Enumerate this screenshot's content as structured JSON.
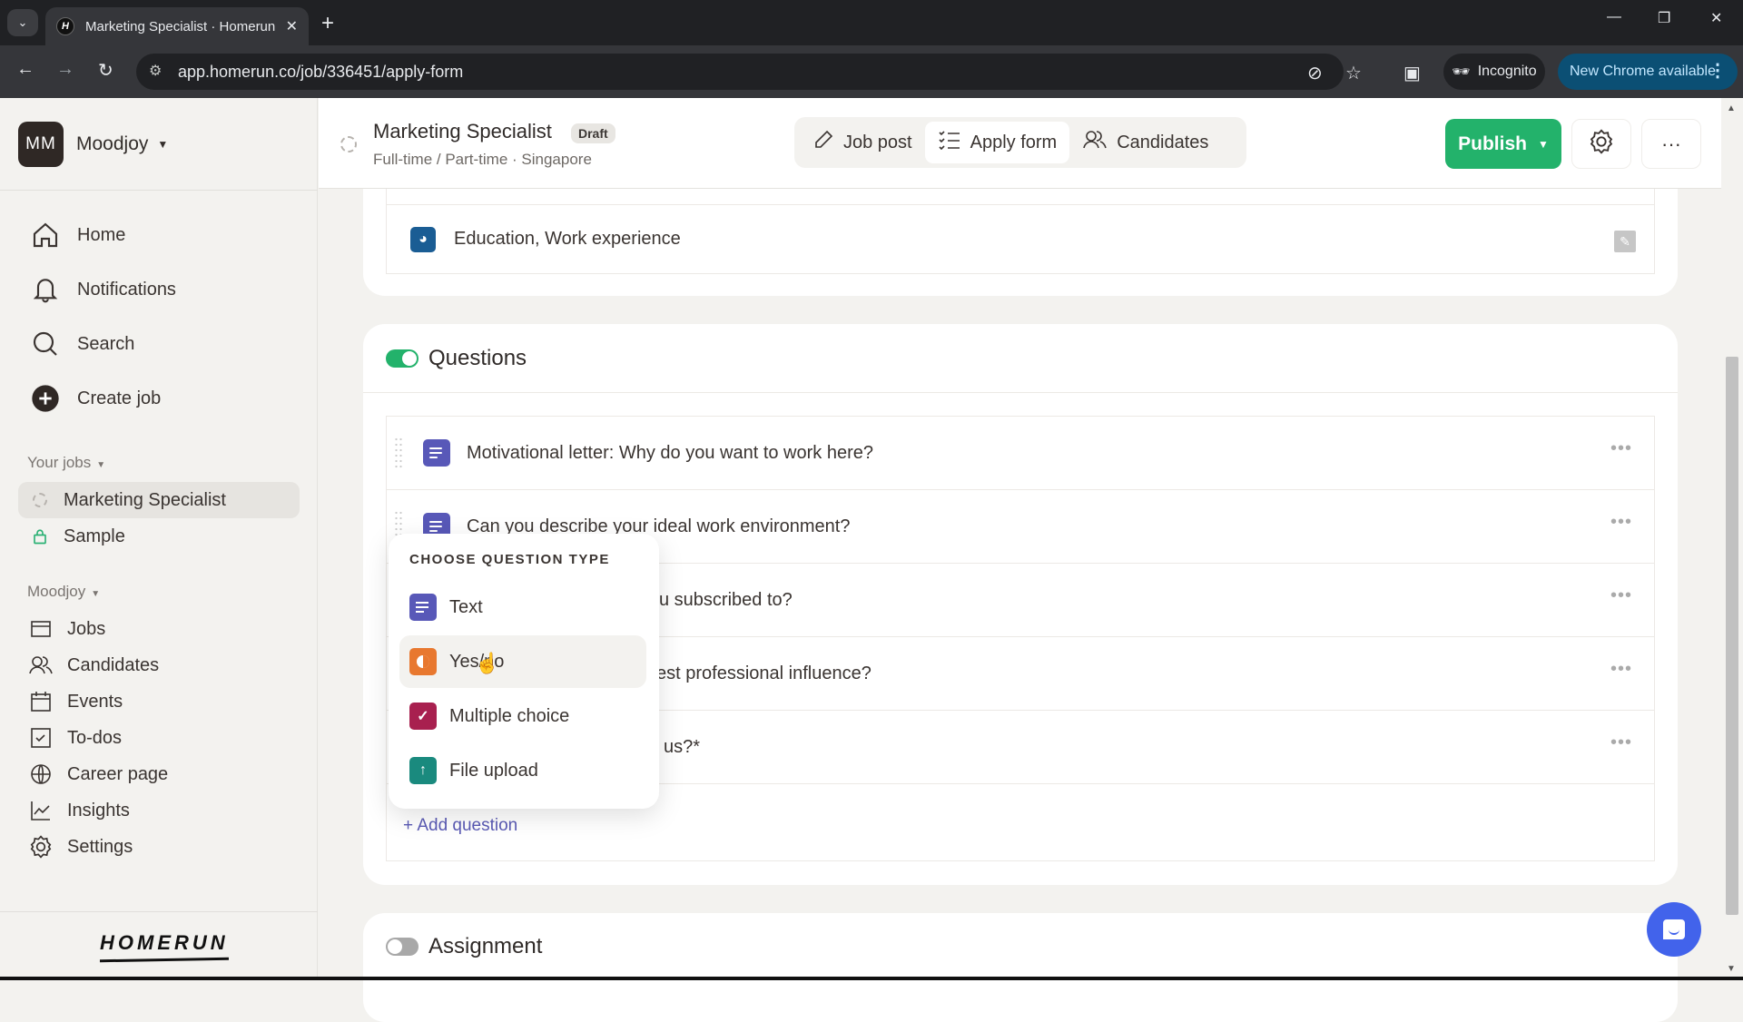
{
  "browser": {
    "tab_title": "Marketing Specialist · Homerun",
    "tab_favicon": "H",
    "url": "app.homerun.co/job/336451/apply-form",
    "incognito_label": "Incognito",
    "update_label": "New Chrome available"
  },
  "sidebar": {
    "org_initials": "MM",
    "org_name": "Moodjoy",
    "main_nav": [
      {
        "label": "Home",
        "icon": "home-icon"
      },
      {
        "label": "Notifications",
        "icon": "bell-icon"
      },
      {
        "label": "Search",
        "icon": "search-icon"
      },
      {
        "label": "Create job",
        "icon": "plus-circle-icon"
      }
    ],
    "your_jobs_label": "Your jobs",
    "jobs": [
      {
        "label": "Marketing Specialist",
        "icon": "draft-status-icon",
        "active": true
      },
      {
        "label": "Sample",
        "icon": "lock-icon",
        "active": false
      }
    ],
    "org_section_label": "Moodjoy",
    "org_nav": [
      {
        "label": "Jobs",
        "icon": "jobs-icon"
      },
      {
        "label": "Candidates",
        "icon": "candidates-icon"
      },
      {
        "label": "Events",
        "icon": "calendar-icon"
      },
      {
        "label": "To-dos",
        "icon": "checkbox-icon"
      },
      {
        "label": "Career page",
        "icon": "globe-icon"
      },
      {
        "label": "Insights",
        "icon": "chart-icon"
      },
      {
        "label": "Settings",
        "icon": "gear-icon"
      }
    ],
    "logo_text": "HOMERUN"
  },
  "header": {
    "job_title": "Marketing Specialist",
    "badge": "Draft",
    "subtitle": "Full-time / Part-time · Singapore",
    "tabs": [
      {
        "label": "Job post",
        "icon": "pencil-icon",
        "active": false
      },
      {
        "label": "Apply form",
        "icon": "checklist-icon",
        "active": true
      },
      {
        "label": "Candidates",
        "icon": "candidates-icon",
        "active": false
      }
    ],
    "publish_label": "Publish"
  },
  "content": {
    "profile_row": "Education, Work experience",
    "questions_section": {
      "title": "Questions",
      "enabled": true,
      "items": [
        "Motivational letter: Why do you want to work here?",
        "Can you describe your ideal work environment?",
        "u subscribed to?",
        "est professional influence?",
        "us?*"
      ],
      "add_label": "+ Add question"
    },
    "assignment_section": {
      "title": "Assignment",
      "enabled": false
    }
  },
  "popover": {
    "heading": "CHOOSE QUESTION TYPE",
    "options": [
      {
        "label": "Text",
        "color": "#5858b8",
        "icon": "text-lines-icon"
      },
      {
        "label": "Yes/no",
        "color": "#e8782f",
        "icon": "half-circle-icon",
        "hovered": true
      },
      {
        "label": "Multiple choice",
        "color": "#a8204f",
        "icon": "check-icon"
      },
      {
        "label": "File upload",
        "color": "#1a8a7e",
        "icon": "upload-arrow-icon"
      }
    ]
  },
  "colors": {
    "accent_green": "#23b26b",
    "link_purple": "#5b5bb5",
    "chat_blue": "#4263eb"
  }
}
